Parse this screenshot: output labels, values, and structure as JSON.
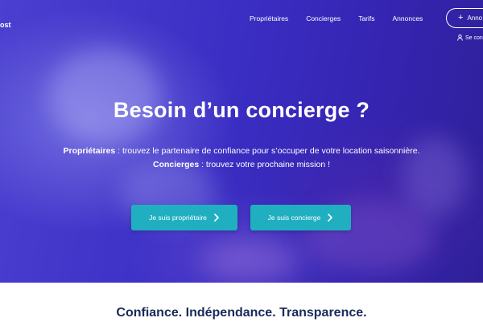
{
  "header": {
    "logo_fragment": "ost",
    "nav": [
      "Propriétaires",
      "Concierges",
      "Tarifs",
      "Annonces"
    ],
    "cta_label": "Anno",
    "login_label": "Se con"
  },
  "hero": {
    "title": "Besoin d’un concierge ?",
    "line1_bold": "Propriétaires",
    "line1_text": " : trouvez le partenaire de confiance pour s’occuper de votre location saisonnière.",
    "line2_bold": "Concierges",
    "line2_text": " : trouvez votre prochaine mission !",
    "buttons": [
      {
        "label": "Je suis propriétaire"
      },
      {
        "label": "Je suis concierge"
      }
    ]
  },
  "tagline": "Confiance. Indépendance. Transparence.",
  "colors": {
    "hero_bg": "#3b2ec4",
    "button_accent": "#20afc0",
    "tagline": "#1a2a5a"
  },
  "icons": {
    "cta": "plus-icon",
    "login": "user-icon",
    "button": "chevron-right-icon"
  }
}
